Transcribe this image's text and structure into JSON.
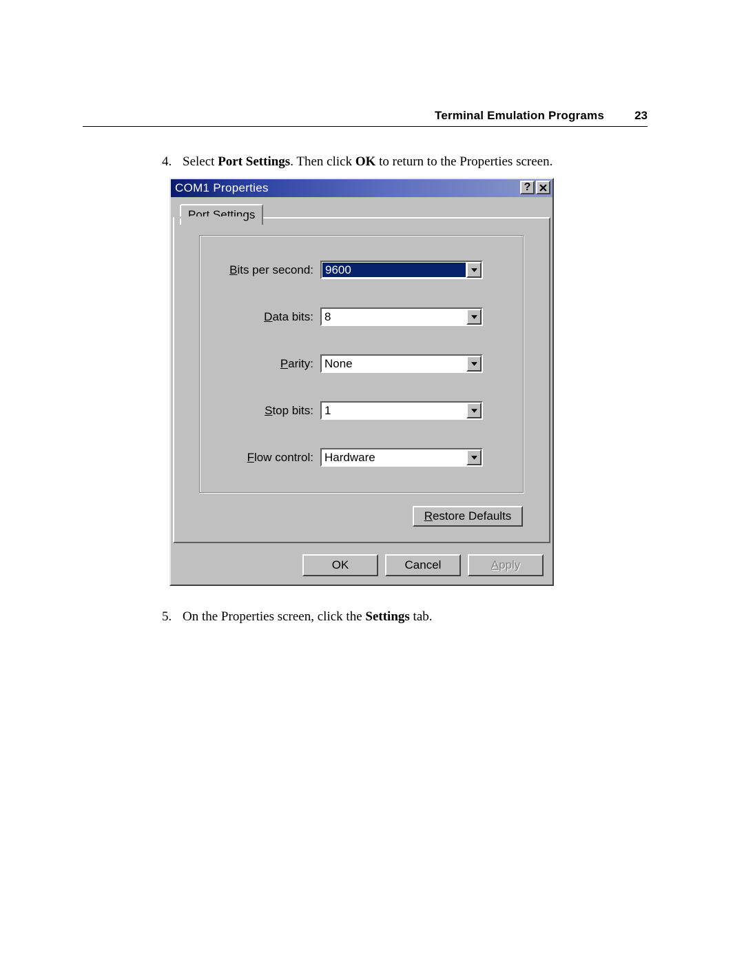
{
  "header": {
    "title": "Terminal Emulation Programs",
    "page_number": "23"
  },
  "steps": {
    "s4": {
      "num": "4.",
      "pre": "Select ",
      "bold1": "Port Settings",
      "mid": ". Then click ",
      "bold2": "OK",
      "post": " to return to the Properties screen."
    },
    "s5": {
      "num": "5.",
      "pre": "On the Properties screen, click the ",
      "bold1": "Settings",
      "post": " tab."
    }
  },
  "dialog": {
    "title": "COM1 Properties",
    "tab_label": "Port Settings",
    "fields": {
      "bits_per_second": {
        "label_u": "B",
        "label_rest": "its per second:",
        "value": "9600"
      },
      "data_bits": {
        "label_u": "D",
        "label_rest": "ata bits:",
        "value": "8"
      },
      "parity": {
        "label_u": "P",
        "label_rest": "arity:",
        "value": "None"
      },
      "stop_bits": {
        "label_u": "S",
        "label_rest": "top bits:",
        "value": "1"
      },
      "flow_control": {
        "label_u": "F",
        "label_rest": "low control:",
        "value": "Hardware"
      }
    },
    "buttons": {
      "restore_u": "R",
      "restore_rest": "estore Defaults",
      "ok": "OK",
      "cancel": "Cancel",
      "apply_u": "A",
      "apply_rest": "pply"
    }
  }
}
